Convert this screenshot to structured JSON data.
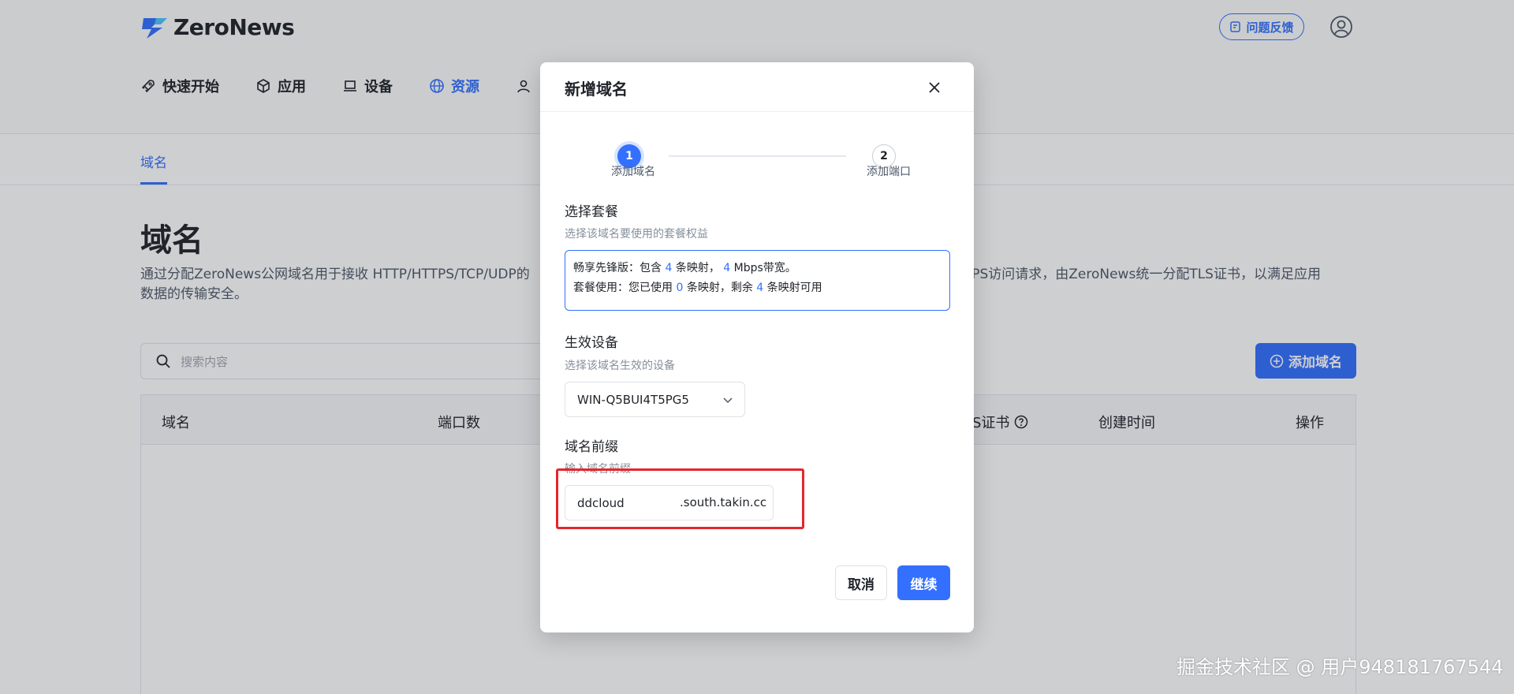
{
  "app": {
    "logo_text": "ZeroNews",
    "feedback_label": "问题反馈"
  },
  "nav": {
    "items": [
      {
        "label": "快速开始",
        "icon": "rocket-icon"
      },
      {
        "label": "应用",
        "icon": "cube-icon"
      },
      {
        "label": "设备",
        "icon": "laptop-icon"
      },
      {
        "label": "资源",
        "icon": "globe-icon",
        "active": true
      }
    ]
  },
  "subtab": {
    "label": "域名"
  },
  "page": {
    "title": "域名",
    "description": "通过分配ZeroNews公网域名用于接收 HTTP/HTTPS/TCP/UDP的",
    "description_right": "TTPS访问请求，由ZeroNews统一分配TLS证书，以满足应用",
    "description_line2": "数据的传输安全。",
    "search_placeholder": "搜索内容",
    "add_domain_label": "添加域名"
  },
  "table": {
    "columns": [
      "域名",
      "端口数",
      "S证书",
      "创建时间",
      "操作"
    ]
  },
  "dialog": {
    "title": "新增域名",
    "steps": [
      {
        "number": "1",
        "label": "添加域名"
      },
      {
        "number": "2",
        "label": "添加端口"
      }
    ],
    "plan": {
      "title": "选择套餐",
      "subtitle": "选择该域名要使用的套餐权益",
      "line1_prefix": "畅享先锋版：包含",
      "line1_num1": "4",
      "line1_mid": "条映射，",
      "line1_num2": "4",
      "line1_suffix": "Mbps带宽。",
      "line2_prefix": "套餐使用：您已使用",
      "line2_num1": "0",
      "line2_mid": "条映射，剩余",
      "line2_num2": "4",
      "line2_suffix": "条映射可用"
    },
    "device": {
      "title": "生效设备",
      "subtitle": "选择该域名生效的设备",
      "selected": "WIN-Q5BUI4T5PG5"
    },
    "prefix": {
      "title": "域名前缀",
      "subtitle": "输入域名前缀",
      "value": "ddcloud",
      "suffix": ".south.takin.cc"
    },
    "cancel_label": "取消",
    "continue_label": "继续"
  },
  "watermark": "掘金技术社区 @ 用户948181767544",
  "colors": {
    "accent": "#3370ff",
    "highlight": "#e5262b"
  }
}
